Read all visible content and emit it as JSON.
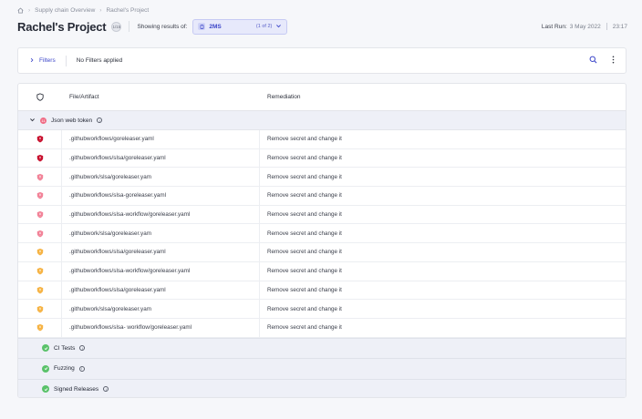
{
  "breadcrumb": {
    "home_icon": "home-icon",
    "items": [
      "Supply chain Overview",
      "Rachel's Project"
    ]
  },
  "header": {
    "title": "Rachel's Project",
    "badge": "1/15",
    "showing_label": "Showing results of:",
    "selector": {
      "value": "2MS",
      "count": "(1 of 2)"
    },
    "last_run_label": "Last Run:",
    "last_run_date": "3 May 2022",
    "last_run_time": "23:17"
  },
  "filterbar": {
    "filters_label": "Filters",
    "status": "No Filters applied"
  },
  "table": {
    "columns": [
      "File/Artifact",
      "Remediation"
    ],
    "open_group": {
      "label": "Json web token",
      "count": "11"
    },
    "rows": [
      {
        "severity": "critical",
        "file": ".githubworkflows/goreleaser.yaml",
        "remediation": "Remove secret and change it"
      },
      {
        "severity": "critical",
        "file": ".githubworkflows/slsa/goreleaser.yaml",
        "remediation": "Remove secret and change it"
      },
      {
        "severity": "high",
        "file": ".githubwork/slsa/goreleaser.yam",
        "remediation": "Remove secret and change it"
      },
      {
        "severity": "high",
        "file": ".githubworkflows/slsa-goreleaser.yaml",
        "remediation": "Remove secret and change it"
      },
      {
        "severity": "high",
        "file": ".githubworkflows/slsa-workflow/goreleaser.yaml",
        "remediation": "Remove secret and change it"
      },
      {
        "severity": "high",
        "file": ".githubwork/slsa/goreleaser.yam",
        "remediation": "Remove secret and change it"
      },
      {
        "severity": "medium",
        "file": ".githubworkflows/slsa/goreleaser.yaml",
        "remediation": "Remove secret and change it"
      },
      {
        "severity": "medium",
        "file": ".githubworkflows/slsa-workflow/goreleaser.yaml",
        "remediation": "Remove secret and change it"
      },
      {
        "severity": "medium",
        "file": ".githubworkflows/slsa/goreleaser.yaml",
        "remediation": "Remove secret and change it"
      },
      {
        "severity": "medium",
        "file": ".githubwork/slsa/goreleaser.yam",
        "remediation": "Remove secret and change it"
      },
      {
        "severity": "medium",
        "file": ".githubworkflows/slsa- workflow/goreleaser.yaml",
        "remediation": "Remove secret and change it"
      }
    ],
    "groups": [
      {
        "label": "CI Tests"
      },
      {
        "label": "Fuzzing"
      },
      {
        "label": "Signed Releases"
      }
    ]
  },
  "colors": {
    "accent": "#3c46c9",
    "critical": "#c8102e",
    "high": "#f06d86",
    "medium": "#f5a623",
    "pass": "#5ac26a"
  }
}
